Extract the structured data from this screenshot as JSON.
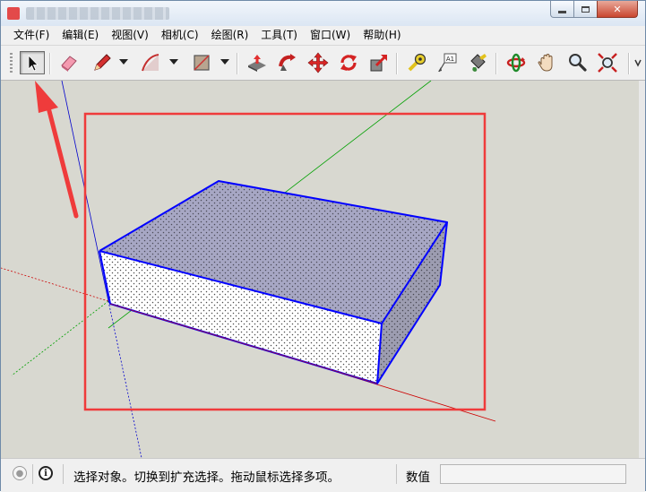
{
  "window": {
    "title": "",
    "controls": {
      "minimize": "minimize",
      "maximize": "maximize",
      "close": "close"
    }
  },
  "menu": [
    {
      "label": "文件(F)"
    },
    {
      "label": "编辑(E)"
    },
    {
      "label": "视图(V)"
    },
    {
      "label": "相机(C)"
    },
    {
      "label": "绘图(R)"
    },
    {
      "label": "工具(T)"
    },
    {
      "label": "窗口(W)"
    },
    {
      "label": "帮助(H)"
    }
  ],
  "toolbar": {
    "tools": [
      {
        "name": "select-tool",
        "icon": "arrow-cursor-icon",
        "active": true
      },
      {
        "name": "eraser-tool",
        "icon": "eraser-icon"
      },
      {
        "name": "pencil-tool",
        "icon": "pencil-icon"
      },
      {
        "name": "arc-tool",
        "icon": "arc-icon"
      },
      {
        "name": "rectangle-tool",
        "icon": "rectangle-icon"
      },
      {
        "name": "push-pull-tool",
        "icon": "push-pull-icon"
      },
      {
        "name": "follow-me-tool",
        "icon": "follow-me-icon"
      },
      {
        "name": "move-tool",
        "icon": "move-icon"
      },
      {
        "name": "rotate-tool",
        "icon": "rotate-icon"
      },
      {
        "name": "scale-tool",
        "icon": "scale-icon"
      },
      {
        "name": "tape-measure-tool",
        "icon": "tape-measure-icon"
      },
      {
        "name": "text-tool",
        "icon": "text-icon",
        "text": "A1"
      },
      {
        "name": "paint-bucket-tool",
        "icon": "paint-bucket-icon"
      },
      {
        "name": "orbit-tool",
        "icon": "orbit-icon"
      },
      {
        "name": "pan-tool",
        "icon": "hand-icon"
      },
      {
        "name": "zoom-tool",
        "icon": "magnifier-icon"
      },
      {
        "name": "zoom-extents-tool",
        "icon": "zoom-extents-icon"
      }
    ]
  },
  "colors": {
    "viewport_bg": "#d8d8d0",
    "selection_edge": "#0000ff",
    "annotation": "#ef3b3b",
    "axis_red": "#cc0000",
    "axis_green": "#00a000",
    "axis_blue": "#0000cc"
  },
  "status": {
    "message": "选择对象。切换到扩充选择。拖动鼠标选择多项。",
    "measurement_label": "数值",
    "measurement_value": ""
  }
}
